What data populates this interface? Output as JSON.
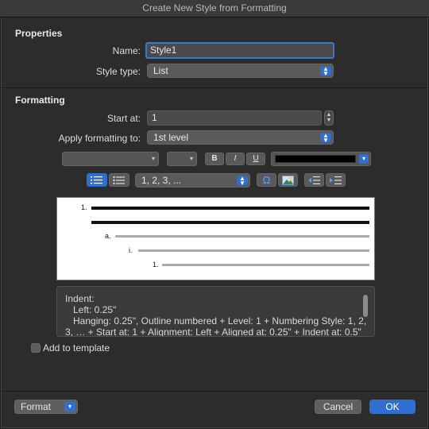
{
  "window": {
    "title": "Create New Style from Formatting"
  },
  "properties": {
    "heading": "Properties",
    "name_label": "Name:",
    "name_value": "Style1",
    "style_type_label": "Style type:",
    "style_type_value": "List"
  },
  "formatting": {
    "heading": "Formatting",
    "start_at_label": "Start at:",
    "start_at_value": "1",
    "apply_label": "Apply formatting to:",
    "apply_value": "1st level",
    "bold_label": "B",
    "italic_label": "I",
    "underline_label": "U",
    "font_color": "#000000",
    "numbering_style_value": "1, 2, 3, ..."
  },
  "preview": {
    "levels": [
      {
        "label": "1."
      },
      {
        "label": "a."
      },
      {
        "label": "i."
      },
      {
        "label": "1."
      }
    ]
  },
  "description": {
    "lines": [
      "Indent:",
      "Left:  0.25\"",
      "Hanging:  0.25\", Outline numbered + Level: 1 + Numbering Style: 1, 2,",
      "3, … + Start at: 1 + Alignment: Left + Aligned at:  0.25\" + Indent at:  0.5\""
    ]
  },
  "add_to_template_label": "Add to template",
  "footer": {
    "format_label": "Format",
    "cancel_label": "Cancel",
    "ok_label": "OK"
  },
  "icons": {
    "numbered_list": "numbered-list-icon",
    "bulleted_list": "bulleted-list-icon",
    "symbol": "omega-icon",
    "picture": "picture-icon",
    "decrease_indent": "decrease-indent-icon",
    "increase_indent": "increase-indent-icon"
  },
  "colors": {
    "accent": "#2f6fd0",
    "background": "#2c2c2c"
  }
}
